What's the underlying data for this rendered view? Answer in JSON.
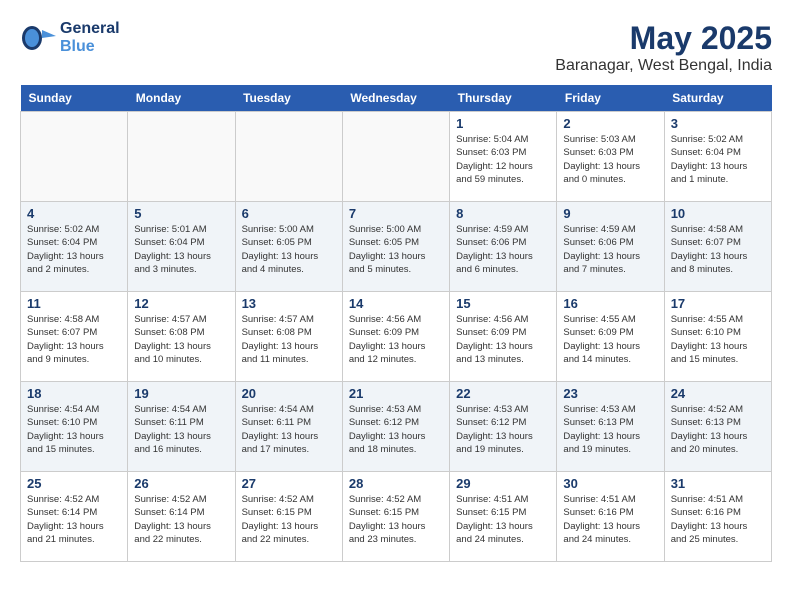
{
  "header": {
    "logo_line1": "General",
    "logo_line2": "Blue",
    "month": "May 2025",
    "location": "Baranagar, West Bengal, India"
  },
  "weekdays": [
    "Sunday",
    "Monday",
    "Tuesday",
    "Wednesday",
    "Thursday",
    "Friday",
    "Saturday"
  ],
  "weeks": [
    [
      {
        "day": "",
        "info": ""
      },
      {
        "day": "",
        "info": ""
      },
      {
        "day": "",
        "info": ""
      },
      {
        "day": "",
        "info": ""
      },
      {
        "day": "1",
        "info": "Sunrise: 5:04 AM\nSunset: 6:03 PM\nDaylight: 12 hours\nand 59 minutes."
      },
      {
        "day": "2",
        "info": "Sunrise: 5:03 AM\nSunset: 6:03 PM\nDaylight: 13 hours\nand 0 minutes."
      },
      {
        "day": "3",
        "info": "Sunrise: 5:02 AM\nSunset: 6:04 PM\nDaylight: 13 hours\nand 1 minute."
      }
    ],
    [
      {
        "day": "4",
        "info": "Sunrise: 5:02 AM\nSunset: 6:04 PM\nDaylight: 13 hours\nand 2 minutes."
      },
      {
        "day": "5",
        "info": "Sunrise: 5:01 AM\nSunset: 6:04 PM\nDaylight: 13 hours\nand 3 minutes."
      },
      {
        "day": "6",
        "info": "Sunrise: 5:00 AM\nSunset: 6:05 PM\nDaylight: 13 hours\nand 4 minutes."
      },
      {
        "day": "7",
        "info": "Sunrise: 5:00 AM\nSunset: 6:05 PM\nDaylight: 13 hours\nand 5 minutes."
      },
      {
        "day": "8",
        "info": "Sunrise: 4:59 AM\nSunset: 6:06 PM\nDaylight: 13 hours\nand 6 minutes."
      },
      {
        "day": "9",
        "info": "Sunrise: 4:59 AM\nSunset: 6:06 PM\nDaylight: 13 hours\nand 7 minutes."
      },
      {
        "day": "10",
        "info": "Sunrise: 4:58 AM\nSunset: 6:07 PM\nDaylight: 13 hours\nand 8 minutes."
      }
    ],
    [
      {
        "day": "11",
        "info": "Sunrise: 4:58 AM\nSunset: 6:07 PM\nDaylight: 13 hours\nand 9 minutes."
      },
      {
        "day": "12",
        "info": "Sunrise: 4:57 AM\nSunset: 6:08 PM\nDaylight: 13 hours\nand 10 minutes."
      },
      {
        "day": "13",
        "info": "Sunrise: 4:57 AM\nSunset: 6:08 PM\nDaylight: 13 hours\nand 11 minutes."
      },
      {
        "day": "14",
        "info": "Sunrise: 4:56 AM\nSunset: 6:09 PM\nDaylight: 13 hours\nand 12 minutes."
      },
      {
        "day": "15",
        "info": "Sunrise: 4:56 AM\nSunset: 6:09 PM\nDaylight: 13 hours\nand 13 minutes."
      },
      {
        "day": "16",
        "info": "Sunrise: 4:55 AM\nSunset: 6:09 PM\nDaylight: 13 hours\nand 14 minutes."
      },
      {
        "day": "17",
        "info": "Sunrise: 4:55 AM\nSunset: 6:10 PM\nDaylight: 13 hours\nand 15 minutes."
      }
    ],
    [
      {
        "day": "18",
        "info": "Sunrise: 4:54 AM\nSunset: 6:10 PM\nDaylight: 13 hours\nand 15 minutes."
      },
      {
        "day": "19",
        "info": "Sunrise: 4:54 AM\nSunset: 6:11 PM\nDaylight: 13 hours\nand 16 minutes."
      },
      {
        "day": "20",
        "info": "Sunrise: 4:54 AM\nSunset: 6:11 PM\nDaylight: 13 hours\nand 17 minutes."
      },
      {
        "day": "21",
        "info": "Sunrise: 4:53 AM\nSunset: 6:12 PM\nDaylight: 13 hours\nand 18 minutes."
      },
      {
        "day": "22",
        "info": "Sunrise: 4:53 AM\nSunset: 6:12 PM\nDaylight: 13 hours\nand 19 minutes."
      },
      {
        "day": "23",
        "info": "Sunrise: 4:53 AM\nSunset: 6:13 PM\nDaylight: 13 hours\nand 19 minutes."
      },
      {
        "day": "24",
        "info": "Sunrise: 4:52 AM\nSunset: 6:13 PM\nDaylight: 13 hours\nand 20 minutes."
      }
    ],
    [
      {
        "day": "25",
        "info": "Sunrise: 4:52 AM\nSunset: 6:14 PM\nDaylight: 13 hours\nand 21 minutes."
      },
      {
        "day": "26",
        "info": "Sunrise: 4:52 AM\nSunset: 6:14 PM\nDaylight: 13 hours\nand 22 minutes."
      },
      {
        "day": "27",
        "info": "Sunrise: 4:52 AM\nSunset: 6:15 PM\nDaylight: 13 hours\nand 22 minutes."
      },
      {
        "day": "28",
        "info": "Sunrise: 4:52 AM\nSunset: 6:15 PM\nDaylight: 13 hours\nand 23 minutes."
      },
      {
        "day": "29",
        "info": "Sunrise: 4:51 AM\nSunset: 6:15 PM\nDaylight: 13 hours\nand 24 minutes."
      },
      {
        "day": "30",
        "info": "Sunrise: 4:51 AM\nSunset: 6:16 PM\nDaylight: 13 hours\nand 24 minutes."
      },
      {
        "day": "31",
        "info": "Sunrise: 4:51 AM\nSunset: 6:16 PM\nDaylight: 13 hours\nand 25 minutes."
      }
    ]
  ]
}
